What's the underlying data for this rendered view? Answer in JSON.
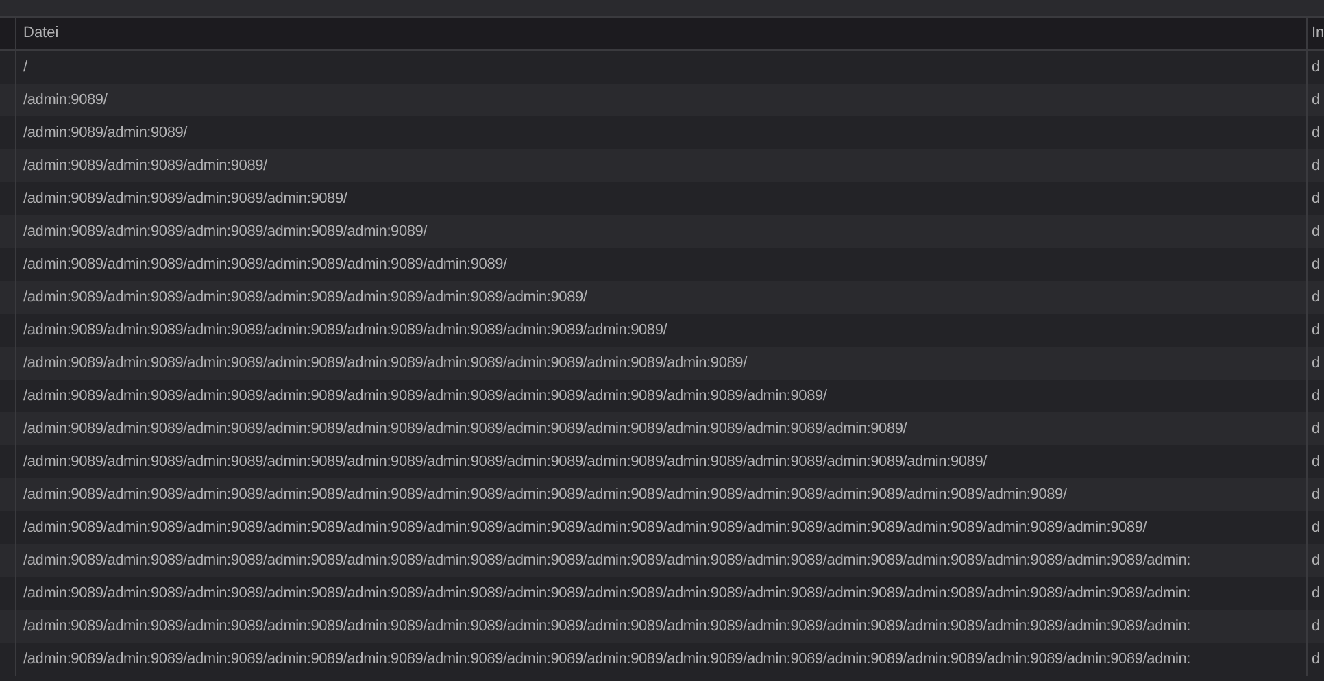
{
  "table": {
    "columns": [
      "Datei",
      "In"
    ],
    "rows": [
      {
        "cells": [
          "/",
          "d"
        ]
      },
      {
        "cells": [
          "/admin:9089/",
          "d"
        ]
      },
      {
        "cells": [
          "/admin:9089/admin:9089/",
          "d"
        ]
      },
      {
        "cells": [
          "/admin:9089/admin:9089/admin:9089/",
          "d"
        ]
      },
      {
        "cells": [
          "/admin:9089/admin:9089/admin:9089/admin:9089/",
          "d"
        ]
      },
      {
        "cells": [
          "/admin:9089/admin:9089/admin:9089/admin:9089/admin:9089/",
          "d"
        ]
      },
      {
        "cells": [
          "/admin:9089/admin:9089/admin:9089/admin:9089/admin:9089/admin:9089/",
          "d"
        ]
      },
      {
        "cells": [
          "/admin:9089/admin:9089/admin:9089/admin:9089/admin:9089/admin:9089/admin:9089/",
          "d"
        ]
      },
      {
        "cells": [
          "/admin:9089/admin:9089/admin:9089/admin:9089/admin:9089/admin:9089/admin:9089/admin:9089/",
          "d"
        ]
      },
      {
        "cells": [
          "/admin:9089/admin:9089/admin:9089/admin:9089/admin:9089/admin:9089/admin:9089/admin:9089/admin:9089/",
          "d"
        ]
      },
      {
        "cells": [
          "/admin:9089/admin:9089/admin:9089/admin:9089/admin:9089/admin:9089/admin:9089/admin:9089/admin:9089/admin:9089/",
          "d"
        ]
      },
      {
        "cells": [
          "/admin:9089/admin:9089/admin:9089/admin:9089/admin:9089/admin:9089/admin:9089/admin:9089/admin:9089/admin:9089/admin:9089/",
          "d"
        ]
      },
      {
        "cells": [
          "/admin:9089/admin:9089/admin:9089/admin:9089/admin:9089/admin:9089/admin:9089/admin:9089/admin:9089/admin:9089/admin:9089/admin:9089/",
          "d"
        ]
      },
      {
        "cells": [
          "/admin:9089/admin:9089/admin:9089/admin:9089/admin:9089/admin:9089/admin:9089/admin:9089/admin:9089/admin:9089/admin:9089/admin:9089/admin:9089/",
          "d"
        ]
      },
      {
        "cells": [
          "/admin:9089/admin:9089/admin:9089/admin:9089/admin:9089/admin:9089/admin:9089/admin:9089/admin:9089/admin:9089/admin:9089/admin:9089/admin:9089/admin:9089/",
          "d"
        ]
      },
      {
        "cells": [
          "/admin:9089/admin:9089/admin:9089/admin:9089/admin:9089/admin:9089/admin:9089/admin:9089/admin:9089/admin:9089/admin:9089/admin:9089/admin:9089/admin:9089/admin:",
          "d"
        ]
      },
      {
        "cells": [
          "/admin:9089/admin:9089/admin:9089/admin:9089/admin:9089/admin:9089/admin:9089/admin:9089/admin:9089/admin:9089/admin:9089/admin:9089/admin:9089/admin:9089/admin:",
          "d"
        ]
      },
      {
        "cells": [
          "/admin:9089/admin:9089/admin:9089/admin:9089/admin:9089/admin:9089/admin:9089/admin:9089/admin:9089/admin:9089/admin:9089/admin:9089/admin:9089/admin:9089/admin:",
          "d"
        ]
      },
      {
        "cells": [
          "/admin:9089/admin:9089/admin:9089/admin:9089/admin:9089/admin:9089/admin:9089/admin:9089/admin:9089/admin:9089/admin:9089/admin:9089/admin:9089/admin:9089/admin:",
          "d"
        ]
      }
    ]
  }
}
